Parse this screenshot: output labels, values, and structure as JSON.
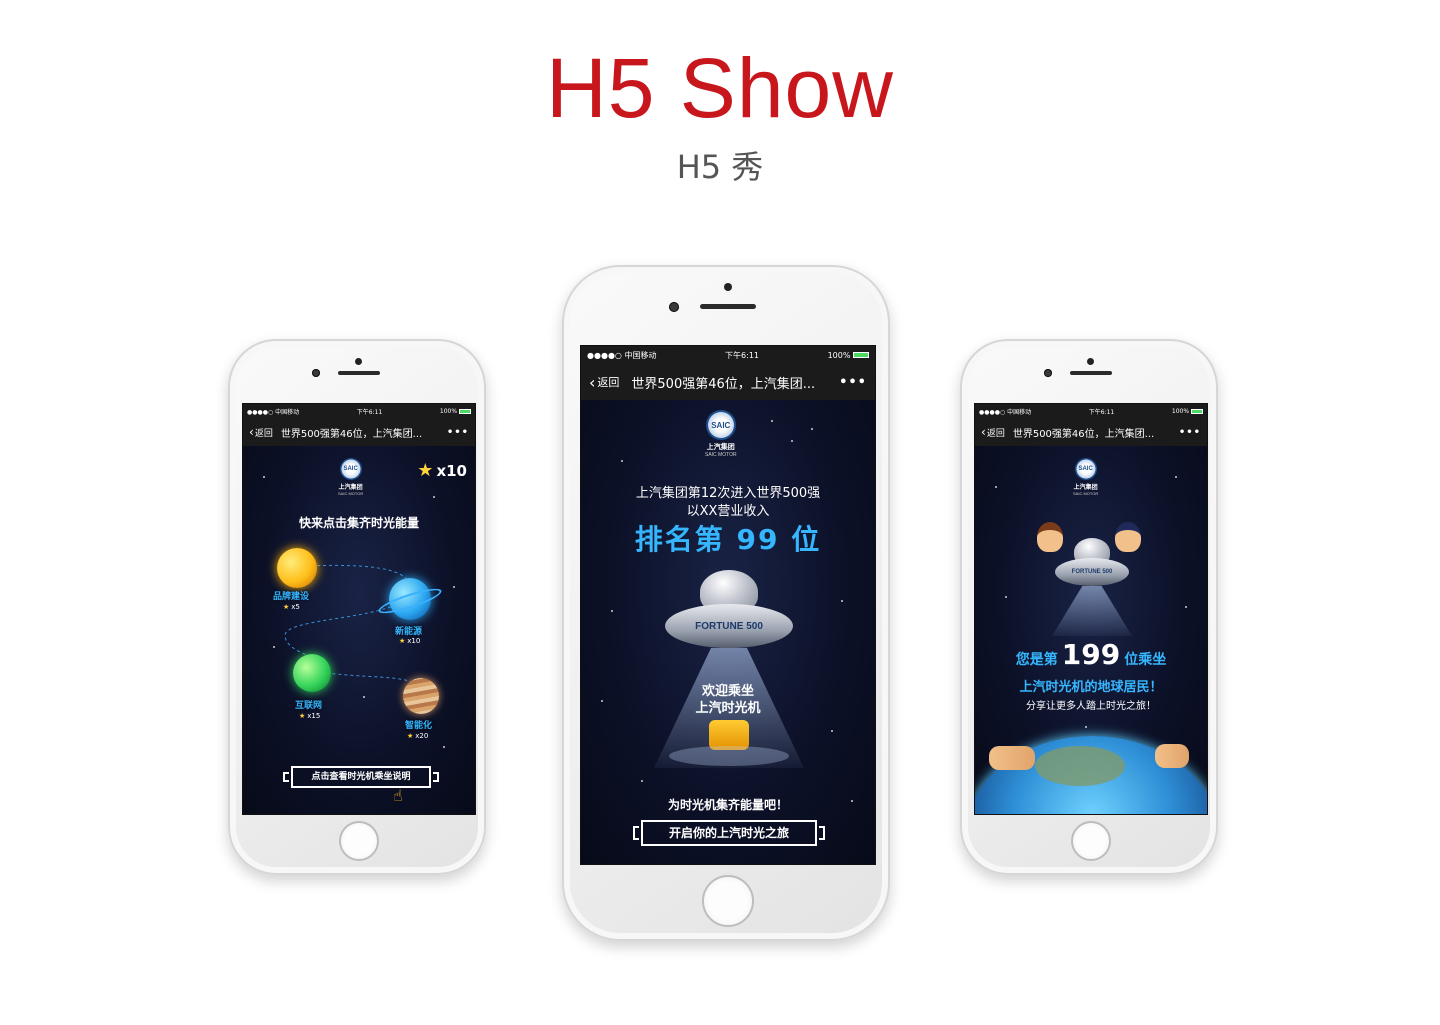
{
  "page": {
    "title": "H5 Show",
    "subtitle": "H5 秀"
  },
  "status": {
    "carrier": "●●●●○ 中国移动",
    "time": "下午6:11",
    "battery": "100%"
  },
  "nav": {
    "back_label": "返回",
    "title": "世界500强第46位，上汽集团...",
    "more": "•••"
  },
  "brand": {
    "badge_text": "SAIC",
    "name": "上汽集团",
    "sub": "SAIC MOTOR"
  },
  "left": {
    "score": "x10",
    "heading": "快来点击集齐时光能量",
    "planets": [
      {
        "label": "品牌建设",
        "count": "x5"
      },
      {
        "label": "新能源",
        "count": "x10"
      },
      {
        "label": "互联网",
        "count": "x15"
      },
      {
        "label": "智能化",
        "count": "x20"
      }
    ],
    "cta": "点击查看时光机乘坐说明"
  },
  "center": {
    "line1": "上汽集团第12次进入世界500强",
    "line2": "以XX营业收入",
    "rank": "排名第 99 位",
    "ufo_label": "FORTUNE 500",
    "welcome1": "欢迎乘坐",
    "welcome2": "上汽时光机",
    "prompt": "为时光机集齐能量吧！",
    "cta": "开启你的上汽时光之旅"
  },
  "right": {
    "ufo_label": "FORTUNE 500",
    "line1_pre": "您是第",
    "number": "199",
    "line1_post": "位乘坐",
    "line2": "上汽时光机的地球居民！",
    "line3": "分享让更多人踏上时光之旅！"
  },
  "colors": {
    "title_red": "#c8161d",
    "accent_blue": "#35b6ff",
    "star_yellow": "#ffd23c"
  }
}
